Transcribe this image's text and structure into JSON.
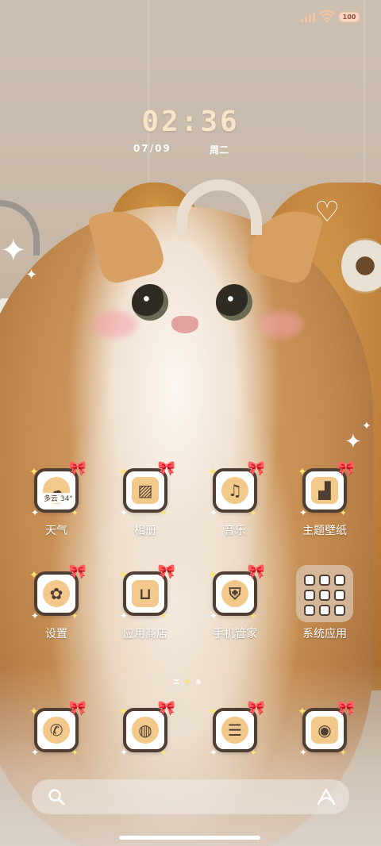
{
  "status_bar": {
    "battery_text": "100",
    "battery_level": 100,
    "signal_bars": 4,
    "accent_color": "#f3c7ae"
  },
  "clock": {
    "time": "02:36",
    "date": "07/09",
    "weekday": "周二",
    "time_color": "#f6e6c7"
  },
  "apps": [
    {
      "label": "天气",
      "icon": "weather-icon",
      "chip": "多云 34°"
    },
    {
      "label": "相册",
      "icon": "gallery-icon"
    },
    {
      "label": "音乐",
      "icon": "music-icon"
    },
    {
      "label": "主题壁纸",
      "icon": "themes-icon"
    },
    {
      "label": "设置",
      "icon": "settings-icon"
    },
    {
      "label": "应用商店",
      "icon": "app-store-icon"
    },
    {
      "label": "手机管家",
      "icon": "security-icon"
    },
    {
      "label": "系统应用",
      "icon": "folder-icon"
    }
  ],
  "page_indicator": {
    "total_pages": 2,
    "current_page": 1
  },
  "dock": [
    {
      "icon": "phone-icon"
    },
    {
      "icon": "browser-icon"
    },
    {
      "icon": "messages-icon"
    },
    {
      "icon": "camera-icon"
    }
  ],
  "search_bar": {
    "left_icon": "search-icon",
    "right_icon": "assistant-icon"
  },
  "theme": {
    "tile_border": "#4f3e33",
    "bow_color": "#ff5ba8",
    "spark_color": "#ffe36a",
    "glyph_fill": "#f2c98a"
  }
}
